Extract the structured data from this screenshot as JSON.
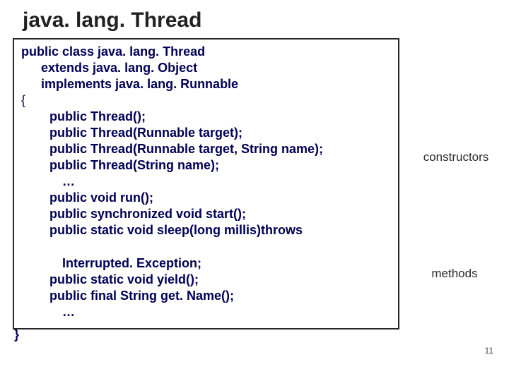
{
  "title": "java. lang. Thread",
  "decl": {
    "line1": "public class java. lang. Thread",
    "line2": "extends java. lang. Object",
    "line3": "implements java. lang. Runnable",
    "open_brace": "{",
    "close_brace": "}"
  },
  "constructors": [
    "public Thread();",
    "public Thread(Runnable target);",
    "public Thread(Runnable target, String name);",
    "public Thread(String name);"
  ],
  "ellipsis": "…",
  "methods": [
    "public void run();",
    "public synchronized void start();",
    "public static void sleep(long millis)throws"
  ],
  "methods_cont": [
    "Interrupted. Exception;",
    "public static void yield();",
    "public final String get. Name();"
  ],
  "annotations": {
    "constructors": "constructors",
    "methods": "methods"
  },
  "page_number": "11"
}
